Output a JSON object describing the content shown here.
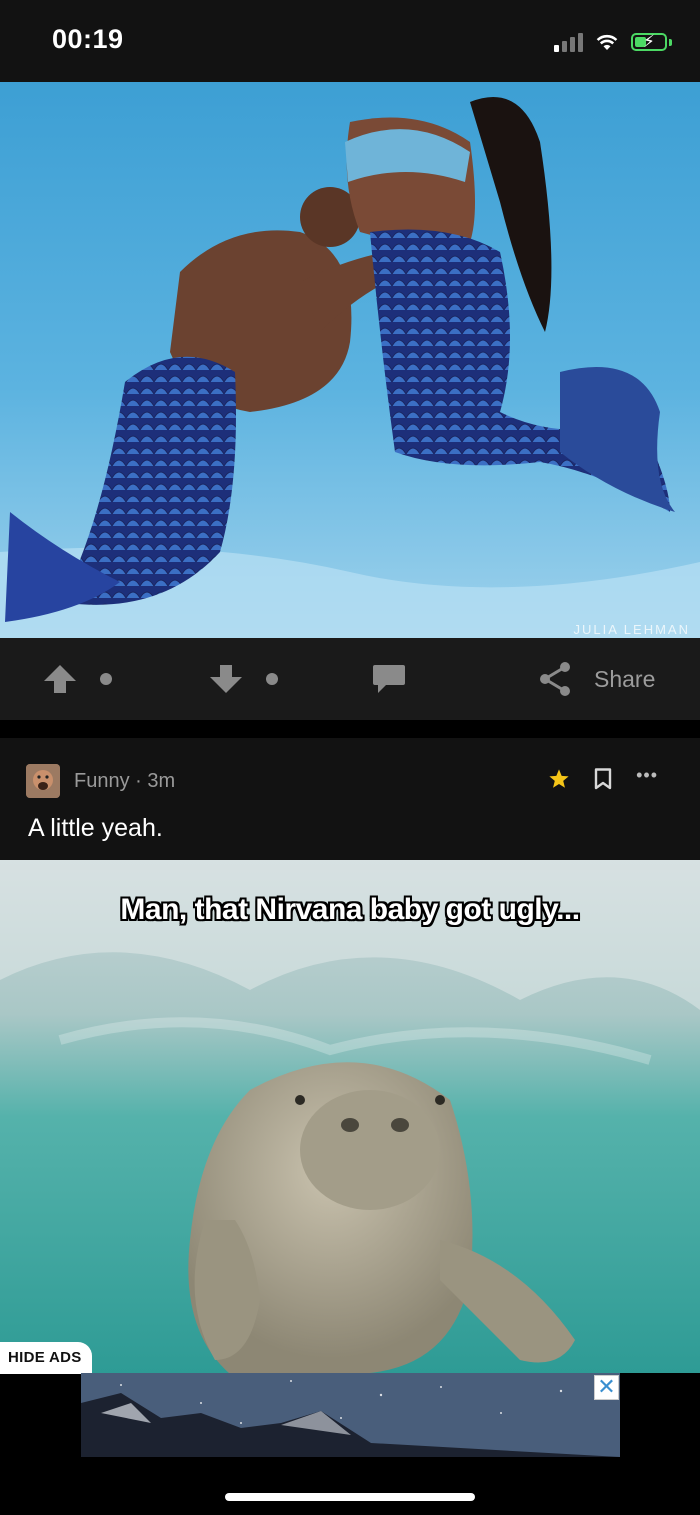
{
  "status_bar": {
    "time": "00:19",
    "signal_bars_active": 1,
    "wifi": "wifi-icon",
    "battery": "battery-charging-icon"
  },
  "post1": {
    "image_alt": "Underwater photo of a couple dressed as mermaids",
    "watermark": "JULIA LEHMAN",
    "actions": {
      "share_label": "Share"
    }
  },
  "post2": {
    "section": "Funny",
    "time_ago": "3m",
    "meta": "Funny · 3m",
    "title": "A little yeah.",
    "caption": "Man, that Nirvana baby got ugly..."
  },
  "ads": {
    "hide_label": "HIDE ADS",
    "close_label": "✕"
  },
  "colors": {
    "background": "#121212",
    "action_bar": "#1a1a1a",
    "icon_gray": "#8a8a8a",
    "star": "#f5c518",
    "battery": "#4cd964"
  }
}
